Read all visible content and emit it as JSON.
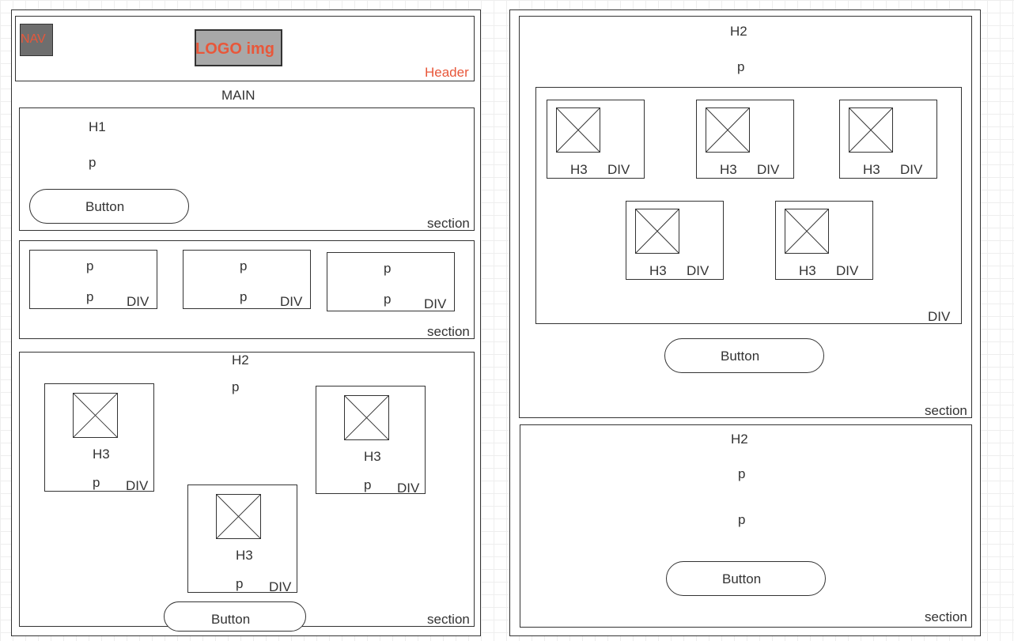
{
  "left_page": {
    "header": {
      "nav": "NAV",
      "logo": "LOGO img",
      "label": "Header"
    },
    "main_label": "MAIN",
    "hero_section": {
      "h1": "H1",
      "p": "p",
      "button": "Button",
      "label": "section"
    },
    "cards_section": {
      "cards": [
        {
          "p1": "p",
          "p2": "p",
          "label": "DIV"
        },
        {
          "p1": "p",
          "p2": "p",
          "label": "DIV"
        },
        {
          "p1": "p",
          "p2": "p",
          "label": "DIV"
        }
      ],
      "label": "section"
    },
    "features_section": {
      "h2": "H2",
      "p": "p",
      "cards": [
        {
          "h3": "H3",
          "p": "p",
          "label": "DIV"
        },
        {
          "h3": "H3",
          "p": "p",
          "label": "DIV"
        },
        {
          "h3": "H3",
          "p": "p",
          "label": "DIV"
        }
      ],
      "button": "Button",
      "label": "section"
    }
  },
  "right_page": {
    "gallery_section": {
      "h2": "H2",
      "p": "p",
      "items": [
        {
          "h3": "H3",
          "label": "DIV"
        },
        {
          "h3": "H3",
          "label": "DIV"
        },
        {
          "h3": "H3",
          "label": "DIV"
        },
        {
          "h3": "H3",
          "label": "DIV"
        },
        {
          "h3": "H3",
          "label": "DIV"
        }
      ],
      "grid_label": "DIV",
      "button": "Button",
      "label": "section"
    },
    "contact_section": {
      "h2": "H2",
      "p1": "p",
      "p2": "p",
      "button": "Button",
      "label": "section"
    }
  },
  "colors": {
    "accent": "#e8573a",
    "nav_fill": "#6e6e6e",
    "logo_fill": "#a8a8a8",
    "stroke": "#333333"
  }
}
